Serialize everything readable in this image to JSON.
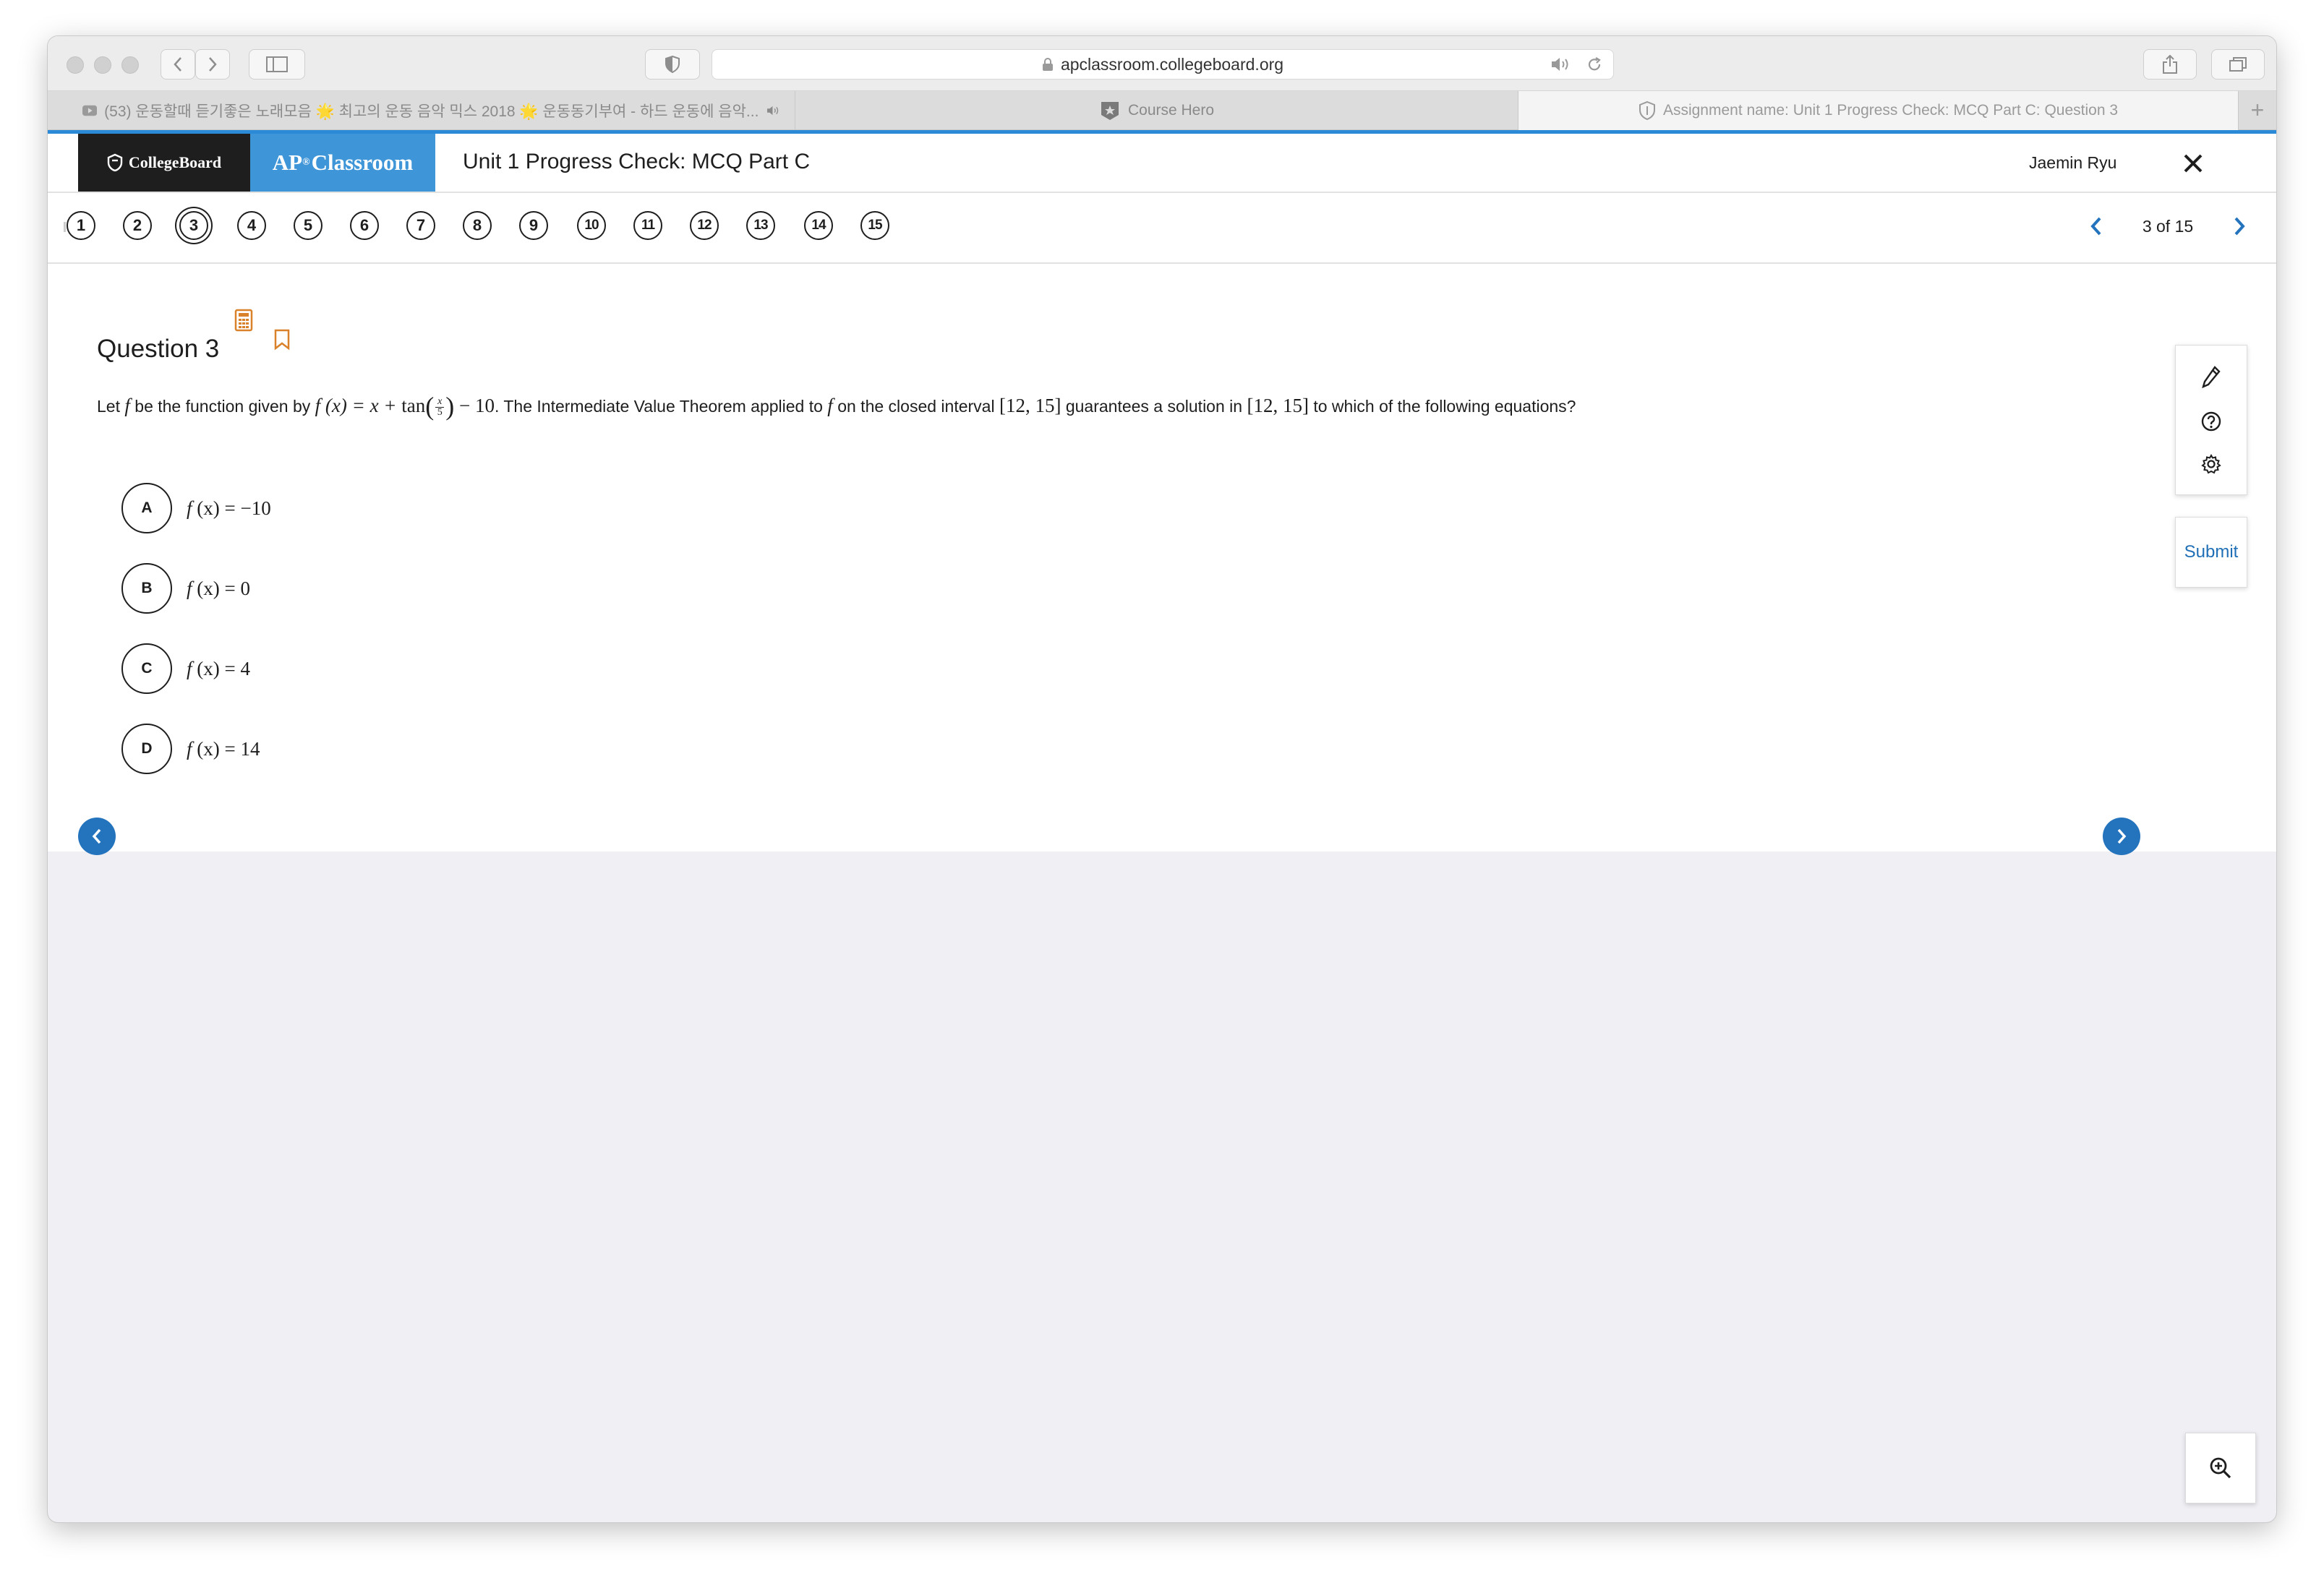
{
  "browser": {
    "url": "apclassroom.collegeboard.org",
    "tabs": [
      {
        "label": "(53) 운동할때 듣기좋은 노래모음 🌟 최고의 운동 음악 믹스 2018 🌟 운동동기부여 - 하드 운동에 음악...",
        "icon": "youtube-icon"
      },
      {
        "label": "Course Hero",
        "icon": "course-hero-icon"
      },
      {
        "label": "Assignment name: Unit 1 Progress Check: MCQ Part C: Question 3",
        "icon": "shield-icon"
      }
    ],
    "new_tab": "+"
  },
  "header": {
    "brand": "CollegeBoard",
    "product_ap": "AP",
    "product_reg": "®",
    "product_classroom": "Classroom",
    "assignment_title": "Unit 1 Progress Check: MCQ Part C",
    "user": "Jaemin Ryu"
  },
  "nav": {
    "questions": [
      "1",
      "2",
      "3",
      "4",
      "5",
      "6",
      "7",
      "8",
      "9",
      "10",
      "11",
      "12",
      "13",
      "14",
      "15"
    ],
    "current": 3,
    "position_text": "3 of 15"
  },
  "question": {
    "title": "Question 3",
    "stem_prefix": "Let",
    "stem_p1": "be the function given by",
    "stem_p2": ". The Intermediate Value Theorem applied to",
    "stem_p3": "on the closed interval",
    "stem_p4": "guarantees a solution in",
    "stem_p5": "to which of the following equations?",
    "f": "f",
    "fx": "f (x) = x + ",
    "tan": "tan",
    "frac_num": "x",
    "frac_den": "5",
    "minus10": " − 10",
    "interval": "[12, 15]",
    "options": [
      {
        "letter": "A",
        "lhs": "f",
        "rhs": " (x) = −10"
      },
      {
        "letter": "B",
        "lhs": "f",
        "rhs": " (x) = 0"
      },
      {
        "letter": "C",
        "lhs": "f",
        "rhs": " (x) = 4"
      },
      {
        "letter": "D",
        "lhs": "f",
        "rhs": " (x) = 14"
      }
    ]
  },
  "tools": {
    "submit_label": "Submit",
    "icons": [
      "pencil-icon",
      "help-icon",
      "settings-icon",
      "zoom-in-icon",
      "calculator-icon",
      "bookmark-icon"
    ]
  },
  "colors": {
    "accent_blue": "#2473bd",
    "ap_blue": "#3e95d8",
    "tab_line": "#2b8ad7",
    "tool_orange": "#d9822b"
  }
}
